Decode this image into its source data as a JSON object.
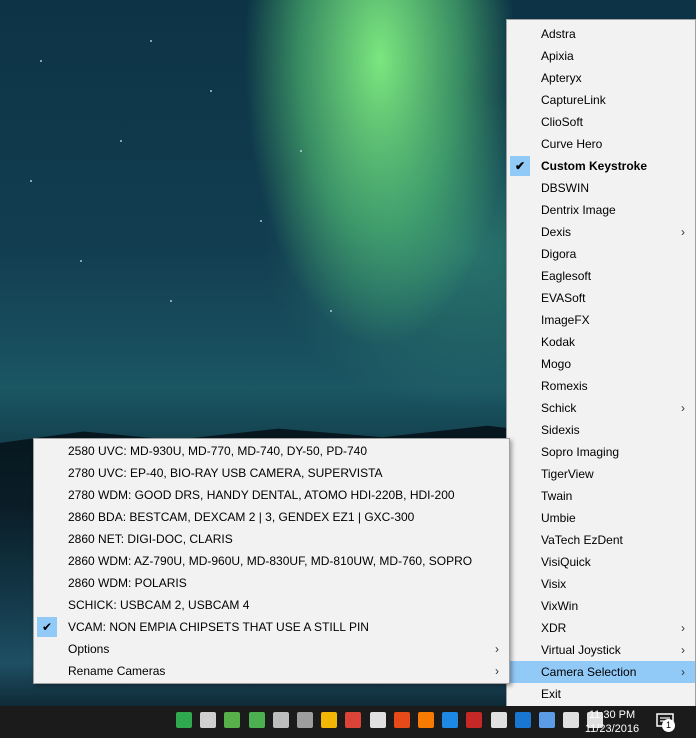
{
  "right_menu": {
    "items": [
      {
        "label": "Adstra"
      },
      {
        "label": "Apixia"
      },
      {
        "label": "Apteryx"
      },
      {
        "label": "CaptureLink"
      },
      {
        "label": "ClioSoft"
      },
      {
        "label": "Curve Hero"
      },
      {
        "label": "Custom Keystroke",
        "checked": true,
        "bold": true
      },
      {
        "label": "DBSWIN"
      },
      {
        "label": "Dentrix Image"
      },
      {
        "label": "Dexis",
        "submenu": true
      },
      {
        "label": "Digora"
      },
      {
        "label": "Eaglesoft"
      },
      {
        "label": "EVASoft"
      },
      {
        "label": "ImageFX"
      },
      {
        "label": "Kodak"
      },
      {
        "label": "Mogo"
      },
      {
        "label": "Romexis"
      },
      {
        "label": "Schick",
        "submenu": true
      },
      {
        "label": "Sidexis"
      },
      {
        "label": "Sopro Imaging"
      },
      {
        "label": "TigerView"
      },
      {
        "label": "Twain"
      },
      {
        "label": "Umbie"
      },
      {
        "label": "VaTech EzDent"
      },
      {
        "label": "VisiQuick"
      },
      {
        "label": "Visix"
      },
      {
        "label": "VixWin"
      },
      {
        "label": "XDR",
        "submenu": true
      },
      {
        "label": "Virtual Joystick",
        "submenu": true
      },
      {
        "label": "Camera Selection",
        "submenu": true,
        "highlighted": true
      },
      {
        "label": "Exit"
      }
    ]
  },
  "camera_menu": {
    "items": [
      {
        "label": "2580 UVC: MD-930U, MD-770, MD-740, DY-50, PD-740"
      },
      {
        "label": "2780 UVC: EP-40, BIO-RAY USB CAMERA, SUPERVISTA"
      },
      {
        "label": "2780 WDM: GOOD DRS, HANDY DENTAL, ATOMO HDI-220B, HDI-200"
      },
      {
        "label": "2860 BDA: BESTCAM, DEXCAM 2 | 3, GENDEX EZ1 | GXC-300"
      },
      {
        "label": "2860 NET: DIGI-DOC, CLARIS"
      },
      {
        "label": "2860 WDM: AZ-790U, MD-960U, MD-830UF, MD-810UW, MD-760, SOPRO"
      },
      {
        "label": "2860 WDM: POLARIS"
      },
      {
        "label": "SCHICK: USBCAM 2, USBCAM 4"
      },
      {
        "label": "VCAM: NON EMPIA CHIPSETS THAT USE A STILL PIN",
        "checked": true
      },
      {
        "label": "Options",
        "submenu": true
      },
      {
        "label": "Rename Cameras",
        "submenu": true
      }
    ]
  },
  "symbols": {
    "check": "✔",
    "arrow": "›"
  },
  "taskbar": {
    "time": "11:30 PM",
    "date": "11/23/2016",
    "notification_count": "1",
    "tray_icons": [
      {
        "name": "green-leaf-icon",
        "color": "#2fa84f"
      },
      {
        "name": "dropbox-icon",
        "color": "#cfcfcf"
      },
      {
        "name": "security-shield-icon",
        "color": "#58b04a"
      },
      {
        "name": "camera-app-icon",
        "color": "#4caf50"
      },
      {
        "name": "document-icon",
        "color": "#bdbdbd"
      },
      {
        "name": "cloud-icon",
        "color": "#9e9e9e"
      },
      {
        "name": "google-drive-icon",
        "color": "#f2b705"
      },
      {
        "name": "chrome-icon",
        "color": "#db4437"
      },
      {
        "name": "printer-icon",
        "color": "#e0e0e0"
      },
      {
        "name": "app-red-icon",
        "color": "#e64a19"
      },
      {
        "name": "app-orange-icon",
        "color": "#f57c00"
      },
      {
        "name": "app-blue-j-icon",
        "color": "#1e88e5"
      },
      {
        "name": "diagram-red-icon",
        "color": "#c62828"
      },
      {
        "name": "usb-drive-icon",
        "color": "#e0e0e0"
      },
      {
        "name": "bluetooth-icon",
        "color": "#1976d2"
      },
      {
        "name": "webcam-icon",
        "color": "#5c9ce6"
      },
      {
        "name": "network-icon",
        "color": "#e0e0e0"
      },
      {
        "name": "volume-icon",
        "color": "#e0e0e0"
      }
    ]
  }
}
